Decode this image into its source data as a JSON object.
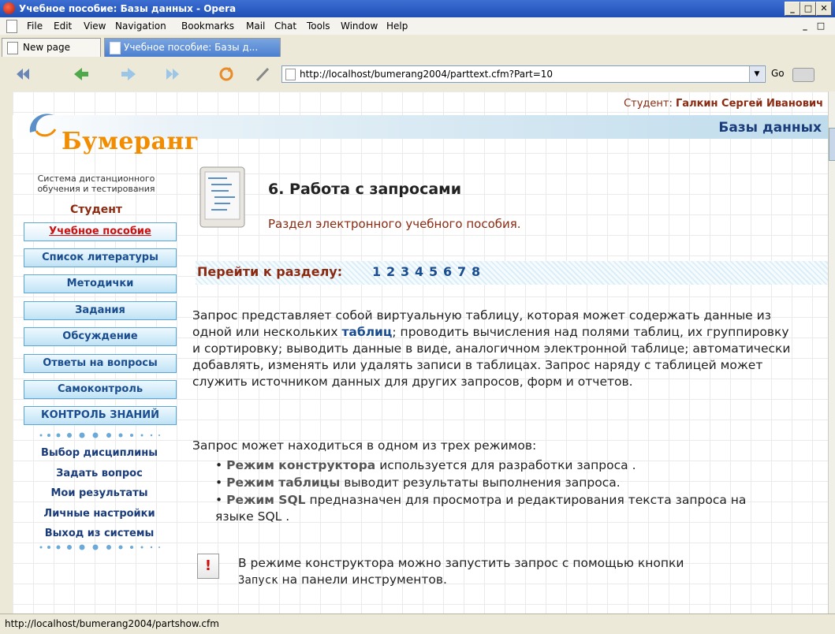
{
  "window": {
    "title": "Учебное пособие: Базы данных - Opera",
    "min": "_",
    "max": "□",
    "close": "✕"
  },
  "menu": [
    "File",
    "Edit",
    "View",
    "Navigation",
    "Bookmarks",
    "Mail",
    "Chat",
    "Tools",
    "Window",
    "Help"
  ],
  "tabs": {
    "new_page": "New page",
    "active": "Учебное пособие: Базы д..."
  },
  "address": {
    "url": "http://localhost/bumerang2004/parttext.cfm?Part=10",
    "go": "Go"
  },
  "header": {
    "student_label": "Студент:",
    "student_name": "Галкин Сергей Иванович",
    "course": "Базы данных",
    "logo": "Бумеранг",
    "tagline1": "Система дистанционного",
    "tagline2": "обучения и тестирования",
    "role": "Студент"
  },
  "sidebar": {
    "buttons": [
      {
        "label": "Учебное пособие",
        "active": true
      },
      {
        "label": "Список литературы",
        "active": false
      },
      {
        "label": "Методички",
        "active": false
      },
      {
        "label": "Задания",
        "active": false
      },
      {
        "label": "Обсуждение",
        "active": false
      },
      {
        "label": "Ответы на вопросы",
        "active": false
      },
      {
        "label": "Самоконтроль",
        "active": false
      },
      {
        "label": "КОНТРОЛЬ ЗНАНИЙ",
        "active": false
      }
    ],
    "links": [
      "Выбор дисциплины",
      "Задать вопрос",
      "Мои результаты",
      "Личные настройки",
      "Выход из системы"
    ]
  },
  "main": {
    "title": "6. Работа с запросами",
    "subtitle": "Раздел электронного учебного пособия.",
    "goto_label": "Перейти к разделу:",
    "sections": [
      "1",
      "2",
      "3",
      "4",
      "5",
      "6",
      "7",
      "8"
    ],
    "p1_a": "Запрос представляет собой виртуальную таблицу, которая может содержать данные из одной или нескольких",
    "p1_link": "таблиц",
    "p1_b": "; проводить вычисления над полями таблиц, их группировку и сортировку; выводить данные в виде, аналогичном электронной таблице; автоматически добавлять, изменять или удалять записи в таблицах. Запрос наряду с таблицей может служить источником данных для других запросов, форм и отчетов.",
    "p2": "Запрос может находиться в одном из трех режимов:",
    "bullets": [
      {
        "term": "Режим конструктора",
        "text": " используется для разработки запроса ."
      },
      {
        "term": "Режим таблицы",
        "text": " выводит результаты выполнения запроса."
      },
      {
        "term": "Режим SQL",
        "text": " предназначен для просмотра и редактирования текста запроса на языке SQL ."
      }
    ],
    "note_icon": "!",
    "note_a": "В режиме конструктора можно запустить запрос с помощью кнопки",
    "note_code": "Запуск",
    "note_b": " на панели инструментов."
  },
  "status": {
    "text": "http://localhost/bumerang2004/partshow.cfm"
  }
}
